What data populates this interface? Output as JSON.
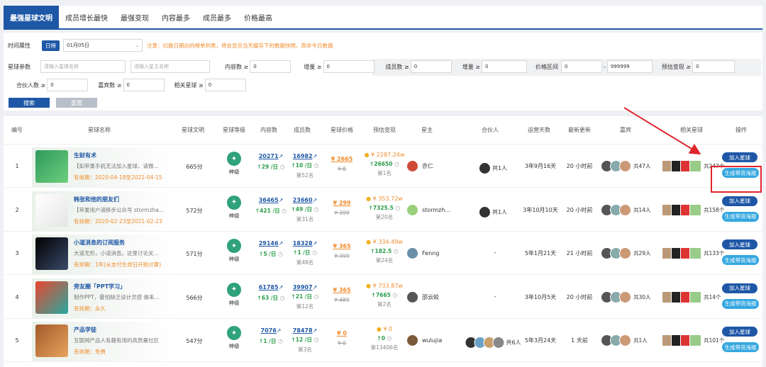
{
  "tabs": [
    "最强星球文明",
    "成员增长最快",
    "最强变现",
    "内容最多",
    "成员最多",
    "价格最高"
  ],
  "filter": {
    "time_label": "时间属性",
    "day_badge": "日榜",
    "date": "01月05日",
    "note": "注意：切换日期后的榜单列表，将会显示当天缓存下的数据快照，而非今日数据",
    "param_label": "星球参数",
    "planet_name_ph": "请输入星球名称",
    "owner_name_ph": "请输入星主名称",
    "content_label": "内容数 ≥",
    "inc_label": "增量 ≥",
    "member_label": "成员数 ≥",
    "price_label": "价格区间",
    "price_min": "0",
    "price_sep": "-",
    "price_max": "999999",
    "cash_label": "预估变现 ≥",
    "partner_label": "合伙人数 ≥",
    "guest_label": "嘉宾数 ≥",
    "related_label": "相关星球 ≥",
    "zero": "0",
    "search_btn": "搜索",
    "reset_btn": "重置"
  },
  "table": {
    "headers": [
      "编号",
      "星球名称",
      "星球文明",
      "星球等级",
      "内容数",
      "成员数",
      "星球价格",
      "预估变现",
      "星主",
      "合伙人",
      "运营天数",
      "最新更新",
      "嘉宾",
      "相关星球",
      "操作"
    ],
    "join_label": "加入星球",
    "poster_label": "生成带货海报",
    "rows": [
      {
        "no": "1",
        "name": "生财有术",
        "desc": "【如苹果手机无法加入星球，请微...",
        "valid": "有效期：2020-04-18至2021-04-15",
        "score": "665分",
        "level": "神级",
        "content": "20271",
        "content_inc": "29 /日",
        "member": "16982",
        "member_inc": "10 /日",
        "member_rank": "第52名",
        "price": "¥ 2665",
        "old_price": "¥ 0",
        "est": "¥ 2287.24w",
        "est_inc": "26650",
        "est_rank": "第1名",
        "owner": "亦仁",
        "partner": "共1人",
        "days": "3年9月16天",
        "update": "20 小时前",
        "guests": "共47人",
        "related": "共247个"
      },
      {
        "no": "2",
        "name": "韩张和他的朋友们",
        "desc": "【苹果用户请移步公众号 stormzha...",
        "valid": "有效期：2020-02-23至2021-02-23",
        "score": "572分",
        "level": "神级",
        "content": "36465",
        "content_inc": "421 /日",
        "member": "23660",
        "member_inc": "49 /日",
        "member_rank": "第31名",
        "price": "¥ 299",
        "old_price": "¥ 399",
        "est": "¥ 353.72w",
        "est_inc": "7325.5",
        "est_rank": "第20名",
        "owner": "stormzh...",
        "partner": "共1人",
        "days": "3年10月10天",
        "update": "20 小时前",
        "guests": "共14人",
        "related": "共158个"
      },
      {
        "no": "3",
        "name": "小道消息的订阅服务",
        "desc": "大道无形，小道消息。这里讨论关...",
        "valid": "有效期：1年(从支付生效日开始计算)",
        "score": "571分",
        "level": "神级",
        "content": "29146",
        "content_inc": "5 /日",
        "member": "18328",
        "member_inc": "1 /日",
        "member_rank": "第48名",
        "price": "¥ 365",
        "old_price": "¥ 399",
        "est": "¥ 334.49w",
        "est_inc": "182.5",
        "est_rank": "第24名",
        "owner": "Fenng",
        "partner": "-",
        "days": "5年1月21天",
        "update": "21 小时前",
        "guests": "共29人",
        "related": "共133个"
      },
      {
        "no": "4",
        "name": "旁友圈「PPT学习」",
        "desc": "制作PPT，最怕缺乏设计灵感 做来...",
        "valid": "有效期：永久",
        "score": "566分",
        "level": "神级",
        "content": "61785",
        "content_inc": "63 /日",
        "member": "39907",
        "member_inc": "21 /日",
        "member_rank": "第12名",
        "price": "¥ 365",
        "old_price": "¥ 489",
        "est": "¥ 733.87w",
        "est_inc": "7665",
        "est_rank": "第2名",
        "owner": "邵云蛟",
        "partner": "-",
        "days": "3年10月5天",
        "update": "20 小时前",
        "guests": "共30人",
        "related": "共14个"
      },
      {
        "no": "5",
        "name": "产品学徒",
        "desc": "互联网产品人有趣有用的高质量社区",
        "valid": "有效期：免费",
        "score": "547分",
        "level": "神级",
        "content": "7076",
        "content_inc": "1 /日",
        "member": "78478",
        "member_inc": "12 /日",
        "member_rank": "第3名",
        "price": "¥ 0",
        "old_price": "¥ 0",
        "est": "¥ 0",
        "est_inc": "0",
        "est_rank": "第13406名",
        "owner": "wulujia",
        "partner": "共6人",
        "days": "5年3月24天",
        "update": "1 天前",
        "guests": "共1人",
        "related": "共101个"
      }
    ]
  },
  "colors": {
    "brand": "#1e57a6",
    "accent": "#f08c2c",
    "up": "#2a9d4a",
    "poster": "#35a7e0",
    "highlight": "#e0262c"
  }
}
